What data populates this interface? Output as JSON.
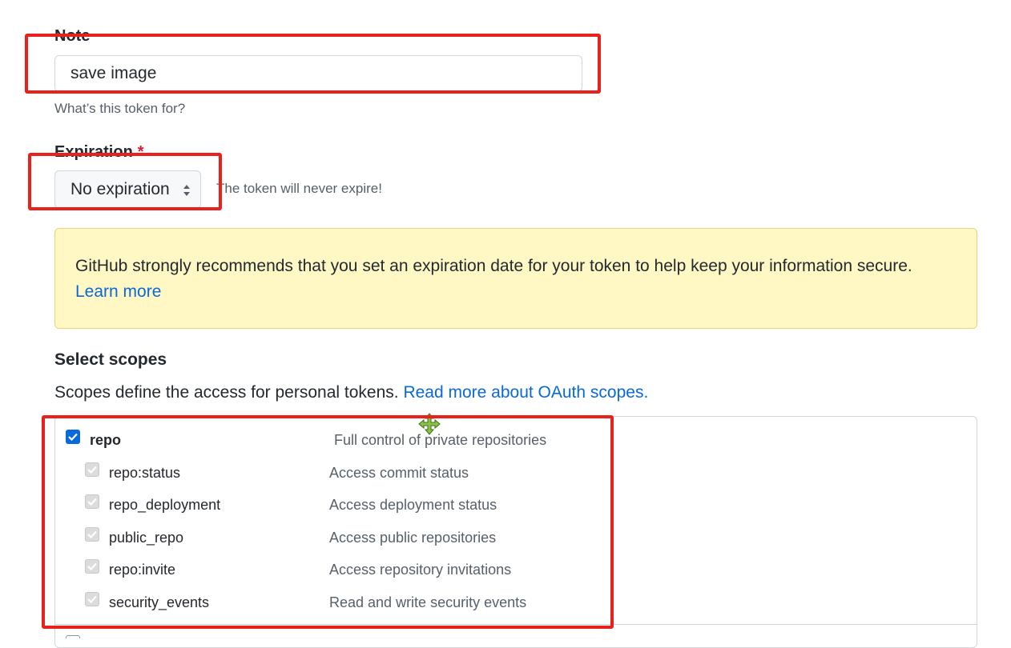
{
  "note": {
    "label": "Note",
    "value": "save image",
    "hint": "What’s this token for?"
  },
  "expiration": {
    "label": "Expiration",
    "required_mark": "*",
    "selected": "No expiration",
    "hint": "The token will never expire!"
  },
  "flash": {
    "message": "GitHub strongly recommends that you set an expiration date for your token to help keep your information secure.",
    "link": "Learn more"
  },
  "scopes": {
    "heading": "Select scopes",
    "description": "Scopes define the access for personal tokens.",
    "link": "Read more about OAuth scopes.",
    "repo": {
      "name": "repo",
      "description": "Full control of private repositories",
      "checked": true
    },
    "children": [
      {
        "name": "repo:status",
        "description": "Access commit status",
        "checked": true
      },
      {
        "name": "repo_deployment",
        "description": "Access deployment status",
        "checked": true
      },
      {
        "name": "public_repo",
        "description": "Access public repositories",
        "checked": true
      },
      {
        "name": "repo:invite",
        "description": "Access repository invitations",
        "checked": true
      },
      {
        "name": "security_events",
        "description": "Read and write security events",
        "checked": true
      }
    ]
  },
  "colors": {
    "accent": "#0969da",
    "annotation": "#e8211d",
    "flash_bg": "#fff8c5"
  }
}
